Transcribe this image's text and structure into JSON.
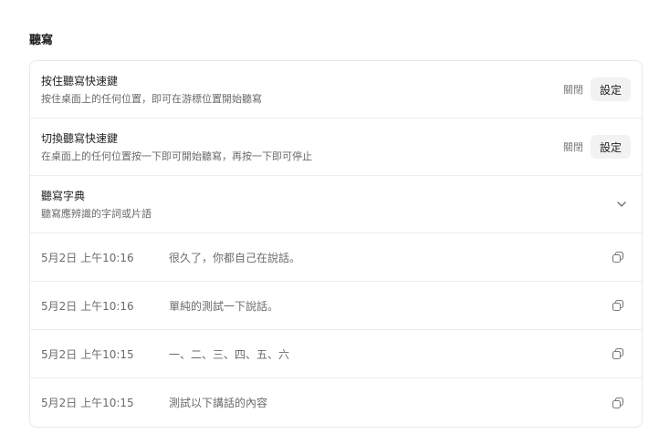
{
  "section": {
    "title": "聽寫"
  },
  "settings": [
    {
      "title": "按住聽寫快速鍵",
      "desc": "按住桌面上的任何位置，即可在游標位置開始聽寫",
      "status": "關閉",
      "button": "設定"
    },
    {
      "title": "切換聽寫快速鍵",
      "desc": "在桌面上的任何位置按一下即可開始聽寫，再按一下即可停止",
      "status": "關閉",
      "button": "設定"
    }
  ],
  "dictionary": {
    "title": "聽寫字典",
    "desc": "聽寫應辨識的字詞或片語",
    "icon": "chevron-down-icon"
  },
  "history": [
    {
      "time": "5月2日 上午10:16",
      "text": "很久了，你都自己在說話。"
    },
    {
      "time": "5月2日 上午10:16",
      "text": "單純的測試一下說話。"
    },
    {
      "time": "5月2日 上午10:15",
      "text": "一、二、三、四、五、六"
    },
    {
      "time": "5月2日 上午10:15",
      "text": "測試以下講話的內容"
    }
  ],
  "icons": {
    "copy": "copy-icon",
    "chevron": "chevron-down-icon"
  },
  "colors": {
    "border": "#e8e8e8",
    "button_bg": "#f2f2f2",
    "muted_text": "#6b6b6b"
  }
}
